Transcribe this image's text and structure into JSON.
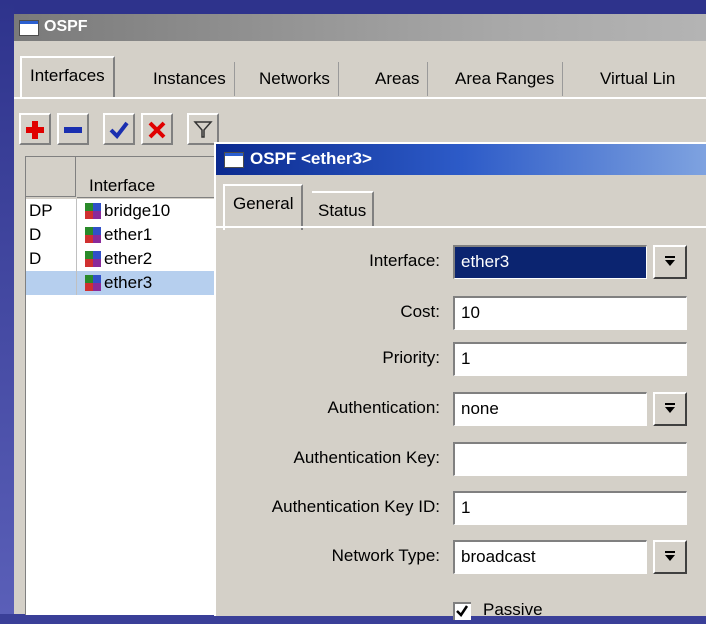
{
  "main_window": {
    "title": "OSPF"
  },
  "tabs": [
    {
      "label": "Interfaces",
      "active": true
    },
    {
      "label": "Instances"
    },
    {
      "label": "Networks"
    },
    {
      "label": "Areas"
    },
    {
      "label": "Area Ranges"
    },
    {
      "label": "Virtual Lin"
    }
  ],
  "toolbar": {
    "add_icon": "plus-icon",
    "remove_icon": "minus-icon",
    "enable_icon": "check-icon",
    "disable_icon": "x-icon",
    "filter_icon": "filter-icon"
  },
  "list": {
    "column_interface": "Interface",
    "rows": [
      {
        "flag": "DP",
        "name": "bridge10"
      },
      {
        "flag": "D",
        "name": "ether1"
      },
      {
        "flag": "D",
        "name": "ether2"
      },
      {
        "flag": "",
        "name": "ether3",
        "selected": true
      }
    ]
  },
  "dialog": {
    "title": "OSPF <ether3>",
    "tabs": [
      "General",
      "Status"
    ],
    "fields": {
      "interface": {
        "label": "Interface:",
        "value": "ether3"
      },
      "cost": {
        "label": "Cost:",
        "value": "10"
      },
      "priority": {
        "label": "Priority:",
        "value": "1"
      },
      "authentication": {
        "label": "Authentication:",
        "value": "none"
      },
      "auth_key": {
        "label": "Authentication Key:",
        "value": ""
      },
      "auth_key_id": {
        "label": "Authentication Key ID:",
        "value": "1"
      },
      "network_type": {
        "label": "Network Type:",
        "value": "broadcast"
      }
    },
    "passive": {
      "label": "Passive",
      "checked": true
    }
  },
  "colors": {
    "dialog_title": "#0b2a8f",
    "selection": "#b6cfee",
    "field_highlight": "#0b2470",
    "desktop": "#3a3f98"
  }
}
